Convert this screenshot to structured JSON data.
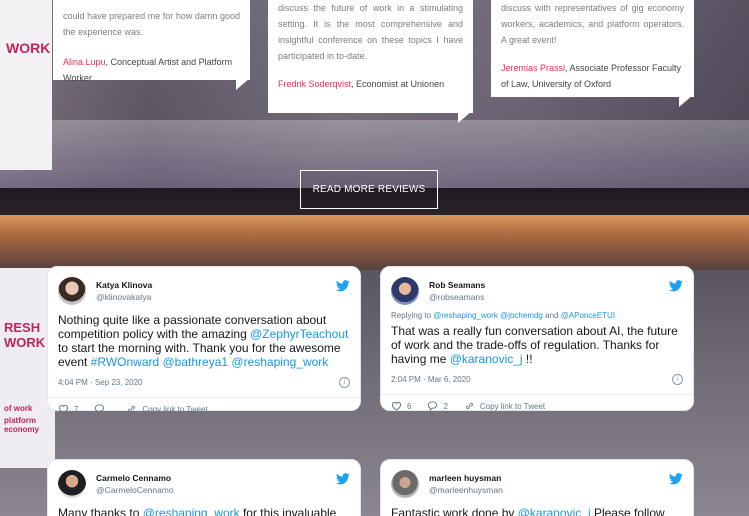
{
  "banner": {
    "top_text": "WORK",
    "lower_text": "RESH WORK",
    "lower_small_1": "of work",
    "lower_small_2": "platform economy"
  },
  "reviews": [
    {
      "text": "could have prepared me for how damn good the experience was.",
      "author_name": "Alina Lupu",
      "author_role": ", Conceptual Artist and Platform Worker"
    },
    {
      "text": "discuss the future of work in a stimulating setting. It is the most comprehensive and insightful conference on these topics I have participated in to-date.",
      "author_name": "Fredrik Soderqvist",
      "author_role": ", Economist at Unionen"
    },
    {
      "text": "discuss with representatives of gig economy workers, academics, and platform operators. A great event!",
      "author_name": "Jeremias Prassl",
      "author_role": ", Associate Professor Faculty of Law, University of Oxford"
    }
  ],
  "read_more_label": "READ MORE REVIEWS",
  "tweets": [
    {
      "name": "Katya Klinova",
      "handle": "@klinovakatya",
      "reply_to": "",
      "text_parts": [
        "Nothing quite like a passionate conversation about competition policy with the amazing ",
        "@ZephyrTeachout",
        " to start the morning with. Thank you for the awesome event ",
        "#RWOnward @bathreya1 @reshaping_work"
      ],
      "timestamp": "4:04 PM · Sep 23, 2020",
      "likes": "7",
      "copy_link": "Copy link to Tweet"
    },
    {
      "name": "Rob Seamans",
      "handle": "@robseamans",
      "reply_prefix": "Replying to ",
      "reply_to": "@reshaping_work @jochemdg",
      "reply_and": " and ",
      "reply_to_2": "@APonceETUI",
      "text_parts": [
        "That was a really fun conversation about AI, the future of work and the trade-offs of regulation. Thanks for having me ",
        "@karanovic_j",
        " !!"
      ],
      "timestamp": "2:04 PM · Mar 6, 2020",
      "likes": "6",
      "replies": "2",
      "copy_link": "Copy link to Tweet"
    },
    {
      "name": "Carmelo Cennamo",
      "handle": "@CarmeloCennamo",
      "text_parts": [
        "Many thanks to ",
        "@reshaping_work",
        " for this invaluable"
      ]
    },
    {
      "name": "marleen huysman",
      "handle": "@marleenhuysman",
      "text_parts": [
        "Fantastic work done by ",
        "@karanovic_j",
        " Please follow her!!"
      ]
    }
  ],
  "colors": {
    "accent_pink": "#e23353",
    "twitter_blue": "#1da1f2",
    "link_blue": "#1b95e0"
  },
  "icons": [
    "twitter-bird-icon",
    "heart-icon",
    "reply-icon",
    "link-icon",
    "info-icon"
  ]
}
